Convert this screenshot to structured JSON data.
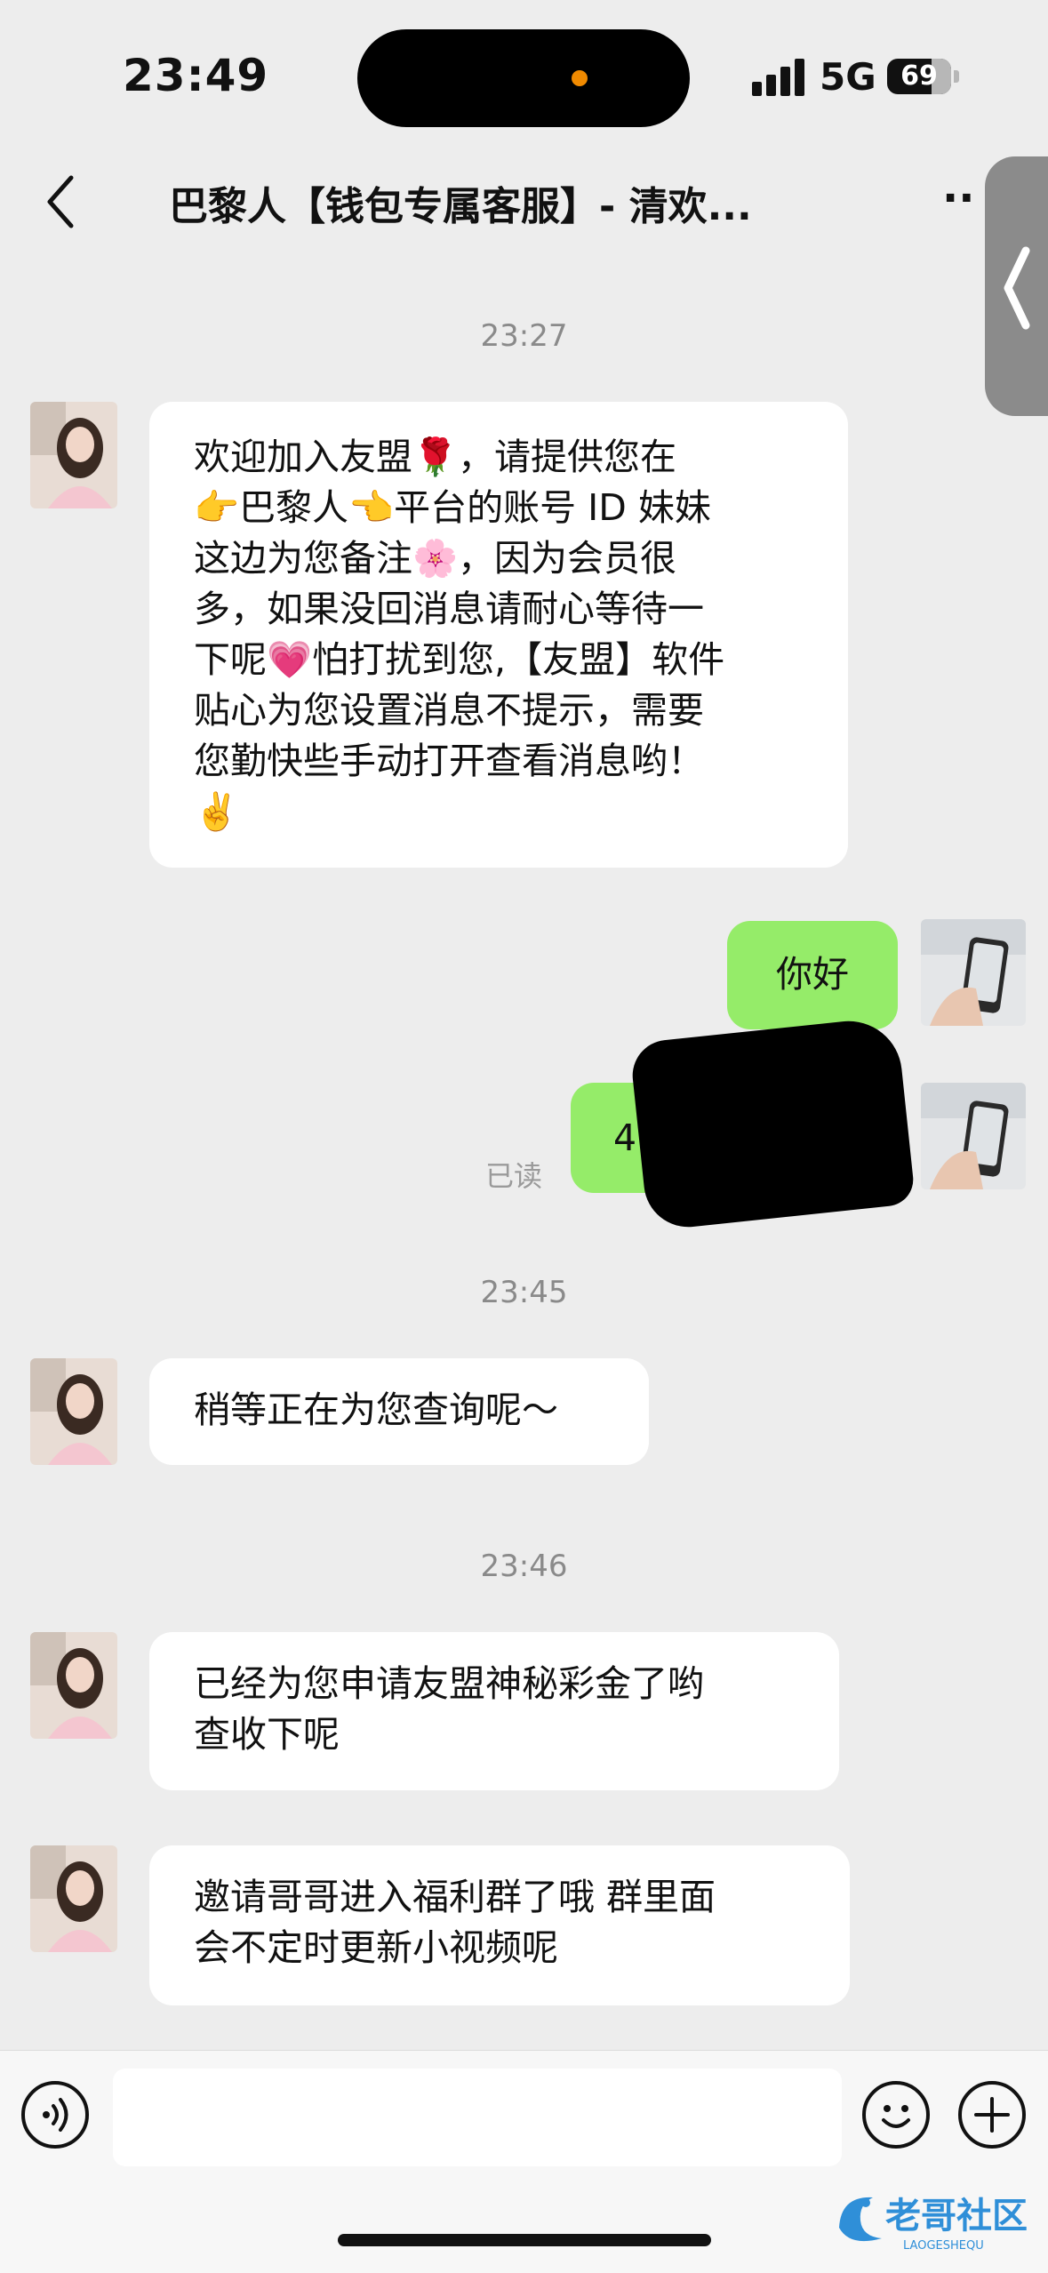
{
  "status_bar": {
    "time": "23:49",
    "network": "5G",
    "battery": "69"
  },
  "nav": {
    "title": "巴黎人【钱包专属客服】- 清欢...",
    "more": "··"
  },
  "messages": {
    "ts1": "23:27",
    "m1_lines": [
      "欢迎加入友盟🌹，请提供您在",
      "👉巴黎人👈平台的账号 ID 妹妹",
      "这边为您备注🌸，因为会员很",
      "多，如果没回消息请耐心等待一",
      "下呢💗怕打扰到您,【友盟】软件",
      "贴心为您设置消息不提示，需要",
      "您勤快些手动打开查看消息哟！",
      "✌️"
    ],
    "m2": "你好",
    "m3": "4",
    "read_status": "已读",
    "ts2": "23:45",
    "m4": "稍等正在为您查询呢～",
    "ts3": "23:46",
    "m5_lines": [
      "已经为您申请友盟神秘彩金了哟",
      "查收下呢"
    ],
    "m6_lines": [
      "邀请哥哥进入福利群了哦  群里面",
      "会不定时更新小视频呢"
    ]
  },
  "watermark": {
    "text": "老哥社区",
    "sub": "LAOGESHEQU"
  },
  "colors": {
    "background": "#ededed",
    "my_bubble": "#95ec69",
    "their_bubble": "#ffffff",
    "timestamp": "#8a8a8a",
    "accent_dot": "#f08a00"
  },
  "icons": [
    "signal-icon",
    "battery-icon",
    "back-chevron-icon",
    "more-icon",
    "side-tab-chevron-icon",
    "voice-icon",
    "emoji-icon",
    "plus-icon"
  ]
}
